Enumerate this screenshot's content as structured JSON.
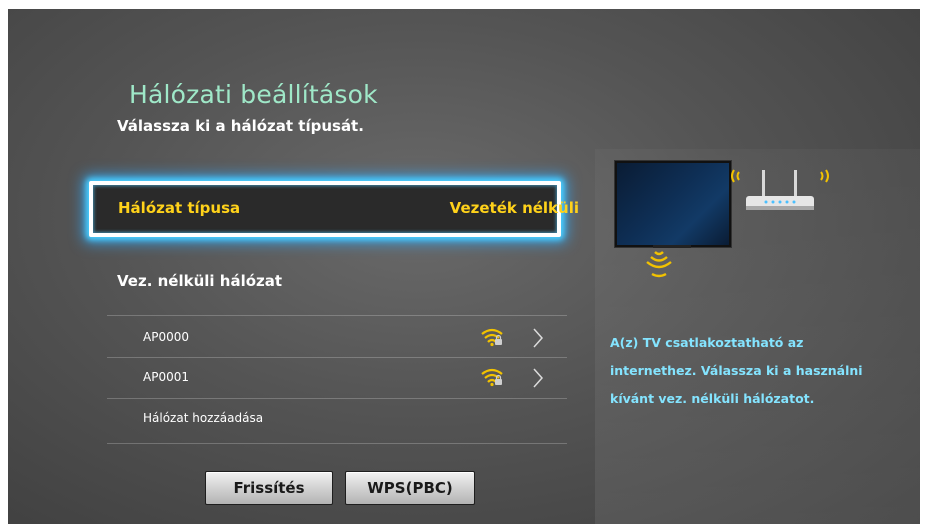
{
  "header": {
    "title": "Hálózati beállítások",
    "subtitle": "Válassza ki a hálózat típusát."
  },
  "network_type": {
    "label": "Hálózat típusa",
    "value": "Vezeték nélküli"
  },
  "wireless_section": {
    "title": "Vez. nélküli hálózat",
    "networks": [
      {
        "name": "AP0000",
        "icon": "wifi-lock-icon"
      },
      {
        "name": "AP0001",
        "icon": "wifi-lock-icon"
      }
    ],
    "add_network": "Hálózat hozzáadása"
  },
  "buttons": {
    "refresh": "Frissítés",
    "wps": "WPS(PBC)"
  },
  "info": {
    "line1": "A(z) TV csatlakoztatható az",
    "line2": "internethez. Válassza ki a használni",
    "line3": "kívánt vez. nélküli hálózatot."
  },
  "colors": {
    "title": "#9fe8c8",
    "highlight_text": "#ffd21a",
    "focus_glow": "#4ad0ff",
    "info_text": "#84e4ff",
    "wifi_signal": "#f2c200"
  }
}
